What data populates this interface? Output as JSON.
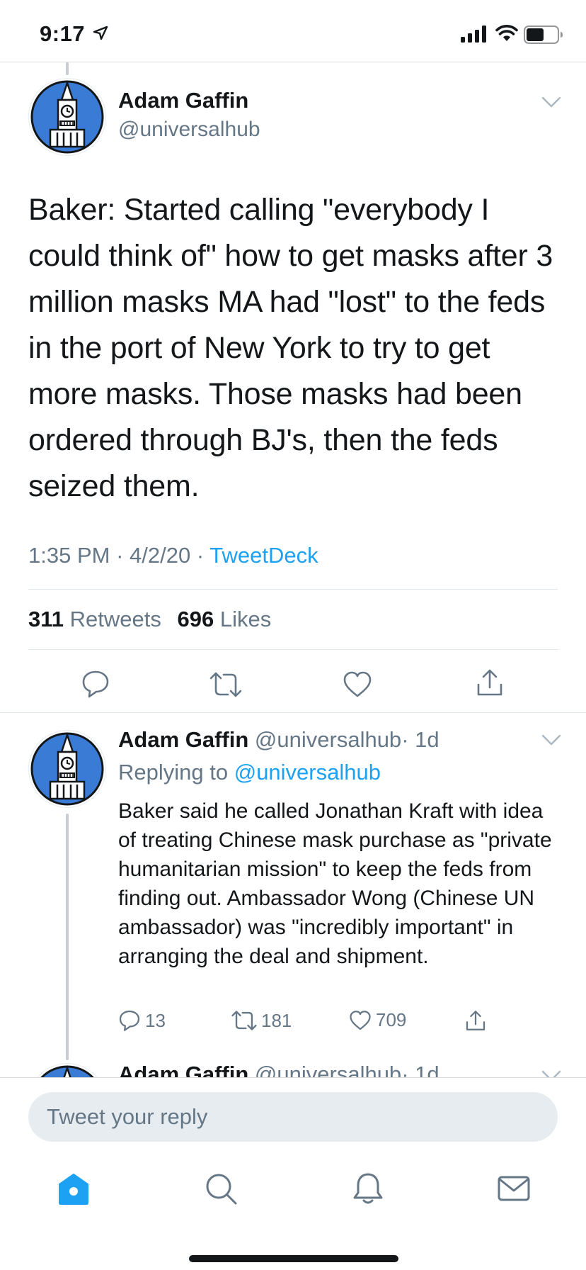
{
  "status_bar": {
    "time": "9:17"
  },
  "main_tweet": {
    "author_name": "Adam Gaffin",
    "author_handle": "@universalhub",
    "text": "Baker: Started calling \"everybody I could think of\" how to get masks after 3 million masks MA had \"lost\" to the feds in the port of New York to try to get more masks. Those masks had been ordered through BJ's, then the feds seized them.",
    "time": "1:35 PM",
    "date": "4/2/20",
    "separator": "·",
    "source": "TweetDeck",
    "retweets_count": "311",
    "retweets_label": "Retweets",
    "likes_count": "696",
    "likes_label": "Likes"
  },
  "reply_tweet": {
    "author_name": "Adam Gaffin",
    "author_handle": "@universalhub",
    "age": "· 1d",
    "replying_label": "Replying to",
    "replying_to": "@universalhub",
    "text": "Baker said he called Jonathan Kraft with idea of treating Chinese mask purchase as \"private humanitarian mission\" to keep the feds from finding out. Ambassador Wong (Chinese UN ambassador) was \"incredibly important\" in arranging the deal and shipment.",
    "replies": "13",
    "retweets": "181",
    "likes": "709"
  },
  "next_tweet": {
    "author_name": "Adam Gaffin",
    "author_handle": "@universalhub",
    "age": "· 1d"
  },
  "composer": {
    "placeholder": "Tweet your reply"
  },
  "colors": {
    "accent": "#1da1f2",
    "secondary_text": "#657786",
    "primary_text": "#14171a",
    "avatar_blue": "#3a7bd5"
  },
  "icons": {
    "tab_home": "home-icon",
    "tab_search": "search-icon",
    "tab_notifications": "bell-icon",
    "tab_messages": "mail-icon"
  }
}
